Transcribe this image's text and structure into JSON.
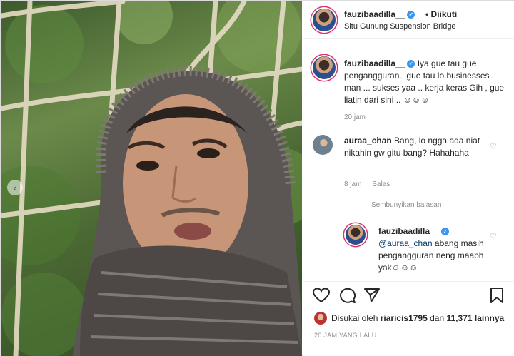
{
  "post": {
    "username": "fauzibaadilla__",
    "follow_status": "• Diikuti",
    "location": "Situ Gunung Suspension Bridge",
    "caption_username": "fauzibaadilla__",
    "caption_text": "Iya gue tau gue pengangguran.. gue tau lo businesses man ... sukses yaa .. kerja keras Gih , gue liatin dari sini .. ☺☺☺",
    "caption_time": "20 jam"
  },
  "comment": {
    "username": "auraa_chan",
    "text": "Bang, lo ngga ada niat nikahin gw gitu bang? Hahahaha",
    "time": "8 jam",
    "reply_label": "Balas",
    "hide_replies": "Sembunyikan balasan"
  },
  "reply": {
    "username": "fauzibaadilla__",
    "mention": "@auraa_chan",
    "text": " abang masih pengangguran neng maaph yak☺☺☺"
  },
  "footer": {
    "liked_by_prefix": "Disukai oleh",
    "liked_by_user": "riaricis1795",
    "liked_by_and": "dan",
    "liked_by_count": "11,371 lainnya",
    "timestamp": "20 JAM YANG LALU"
  },
  "icons": {
    "verified": "verified-badge",
    "like": "heart-icon",
    "comment": "comment-icon",
    "share": "share-icon",
    "save": "bookmark-icon",
    "carousel_prev": "chevron-left-icon"
  },
  "colors": {
    "verified_blue": "#3897f0",
    "story_ring": "#e1306c",
    "secondary_text": "#8e8e8e",
    "mention": "#00376b"
  }
}
